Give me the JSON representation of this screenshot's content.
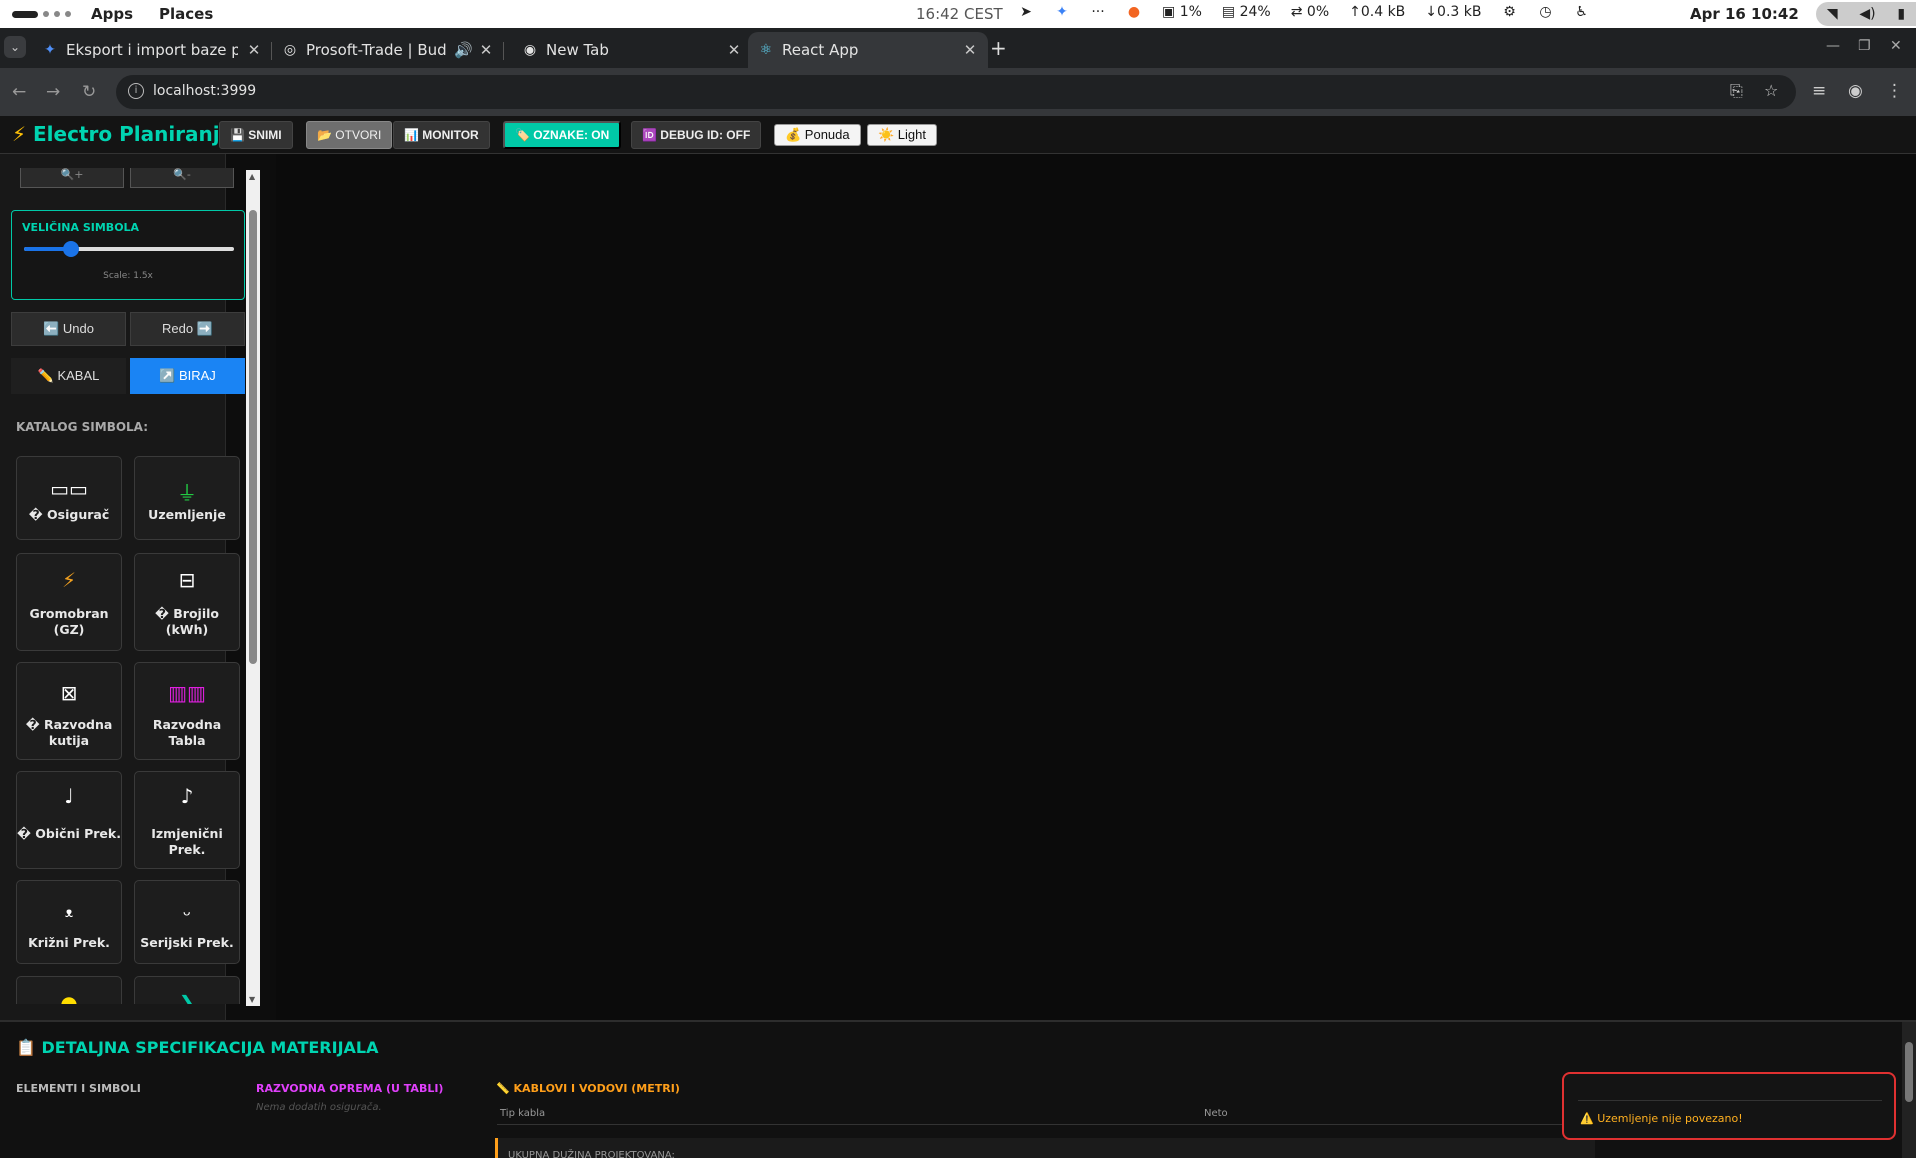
{
  "topbar": {
    "apps": "Apps",
    "places": "Places",
    "clock_small": "16:42 CEST",
    "cpu": "1%",
    "mem": "24%",
    "swap": "0%",
    "net_up": "0.4 kB",
    "net_down": "0.3 kB",
    "date": "Apr 16  10:42",
    "tray_icons": [
      "telegram-icon",
      "sparkle-icon",
      "more-icon",
      "alert-icon",
      "cpu-icon",
      "memory-icon",
      "swap-icon",
      "upload-icon",
      "download-icon",
      "extension-icon",
      "clock-icon",
      "accessibility-icon",
      "wifi-icon",
      "volume-icon",
      "battery-icon"
    ]
  },
  "browser": {
    "tabs": [
      {
        "title": "Eksport i import baze pod",
        "icon": "gemini-icon",
        "active": false
      },
      {
        "title": "Prosoft-Trade | Budućn",
        "icon": "globe-icon",
        "active": false,
        "audio": true
      },
      {
        "title": "New Tab",
        "icon": "chrome-icon",
        "active": false
      },
      {
        "title": "React App",
        "icon": "react-icon",
        "active": true
      }
    ],
    "url": "localhost:3999"
  },
  "app": {
    "brand": "Electro Planiranje",
    "brand_icon": "⚡",
    "toolbar": {
      "save": "💾 SNIMI",
      "open": "📂 OTVORI",
      "monitor": "📊 MONITOR",
      "labels": "🏷️ OZNAKE: ON",
      "debug": "🆔 DEBUG ID: OFF",
      "offer": "💰 Ponuda",
      "theme": "☀️ Light"
    },
    "sidebar": {
      "zoom_in": "🔍+",
      "zoom_out": "🔍-",
      "scale_label": "VELIČINA SIMBOLA",
      "scale_value": 1.5,
      "scale_min": 0.5,
      "scale_max": 5,
      "scale_text": "Scale: 1.5x",
      "undo": "⬅️ Undo",
      "redo": "Redo ➡️",
      "mode_cable": "✏️ KABAL",
      "mode_select": "↗️ BIRAJ",
      "catalog_label": "KATALOG SIMBOLA:",
      "symbols": [
        {
          "name": "� Osigurač",
          "glyph": "▭▭",
          "color": "#ffffff",
          "icon": "fuse-icon"
        },
        {
          "name": "Uzemljenje",
          "glyph": "⏚",
          "color": "#22cc44",
          "icon": "ground-icon"
        },
        {
          "name": "Gromobran (GZ)",
          "glyph": "⚡",
          "color": "#f0a020",
          "icon": "lightning-rod-icon"
        },
        {
          "name": "� Brojilo (kWh)",
          "glyph": "⊟",
          "color": "#ffffff",
          "icon": "meter-icon"
        },
        {
          "name": "� Razvodna kutija",
          "glyph": "⊠",
          "color": "#ffffff",
          "icon": "junction-box-icon"
        },
        {
          "name": "Razvodna Tabla",
          "glyph": "▥▥",
          "color": "#e020e0",
          "icon": "distribution-board-icon"
        },
        {
          "name": "� Obični Prek.",
          "glyph": "♩",
          "color": "#ffffff",
          "icon": "simple-switch-icon"
        },
        {
          "name": "Izmjenični Prek.",
          "glyph": "♪",
          "color": "#ffffff",
          "icon": "two-way-switch-icon"
        },
        {
          "name": "Križni Prek.",
          "glyph": "ᵜ",
          "color": "#ffffff",
          "icon": "cross-switch-icon"
        },
        {
          "name": "Serijski Prek.",
          "glyph": "ᵕ",
          "color": "#ffffff",
          "icon": "series-switch-icon"
        },
        {
          "name": "",
          "glyph": "●",
          "color": "#ffdd00",
          "icon": "lamp-icon"
        },
        {
          "name": "",
          "glyph": "❯",
          "color": "#00c9a7",
          "icon": "socket-icon"
        }
      ]
    },
    "spec": {
      "title": "📋 DETALJNA SPECIFIKACIJA MATERIJALA",
      "col_elements": "ELEMENTI I SIMBOLI",
      "col_board": "RAZVODNA OPREMA (U TABLI)",
      "board_empty": "Nema dodatih osigurača.",
      "col_cables": "📏 KABLOVI I VODOVI (METRI)",
      "th_type": "Tip kabla",
      "th_net": "Neto",
      "total": "UKUPNA DUŽINA PROJEKTOVANA:"
    },
    "toast": "⚠️ Uzemljenje nije povezano!"
  }
}
